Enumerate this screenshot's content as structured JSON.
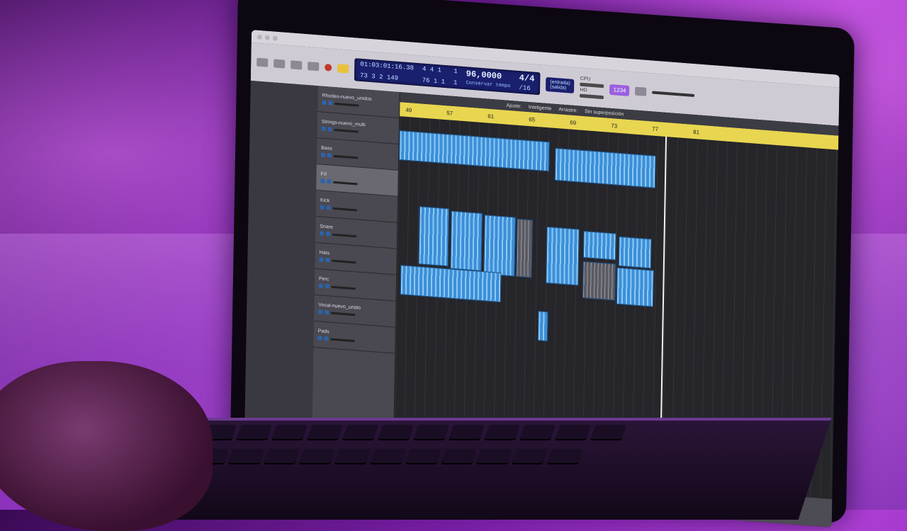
{
  "transport": {
    "timecode": "01:03:01:16.38",
    "bars_beats": "73 3 2 149",
    "position_top": "4 4 1",
    "position_bottom": "76 1 1",
    "sub_top": "1",
    "sub_bottom": "1",
    "tempo": "96,0000",
    "tempo_label": "Conservar tempo",
    "signature": "4/4",
    "division": "/16",
    "input_label": "(entrada)",
    "output_label": "(salida)",
    "badge": "1234"
  },
  "cpu": {
    "cpu_label": "CPU",
    "hd_label": "HD"
  },
  "arrange": {
    "snap_label": "Ajuste:",
    "snap_value": "Inteligente",
    "drag_label": "Arrastre:",
    "drag_value": "Sin superposición",
    "ruler": [
      "49",
      "57",
      "61",
      "65",
      "69",
      "73",
      "77",
      "81"
    ]
  },
  "tracks": [
    {
      "name": "Rhodes-nuevo_unidos",
      "selected": false
    },
    {
      "name": "Strings-nuevo_multi",
      "selected": false
    },
    {
      "name": "Bass",
      "selected": false
    },
    {
      "name": "FX",
      "selected": true
    },
    {
      "name": "Kick",
      "selected": false
    },
    {
      "name": "Snare",
      "selected": false
    },
    {
      "name": "Hats",
      "selected": false
    },
    {
      "name": "Perc",
      "selected": false
    },
    {
      "name": "Vocal-nuevo_unido",
      "selected": false
    },
    {
      "name": "Pads",
      "selected": false
    }
  ],
  "dock": [
    {
      "icon": "finder-icon",
      "color": "#3a8ee6"
    },
    {
      "icon": "launchpad-icon",
      "color": "#7a7a88"
    },
    {
      "icon": "safari-icon",
      "color": "#2e8fe0"
    },
    {
      "icon": "photos-icon",
      "color": "#e9a03b"
    },
    {
      "icon": "files-icon",
      "color": "#4a9ae8"
    },
    {
      "icon": "chrome-icon",
      "color": "#e84a3b"
    },
    {
      "icon": "notes-icon",
      "color": "#f2d14a"
    },
    {
      "icon": "calendar-icon",
      "color": "#f0f0f0"
    },
    {
      "icon": "appletv-icon",
      "color": "#111111"
    },
    {
      "icon": "systemprefs-icon",
      "color": "#8a8a90"
    },
    {
      "icon": "appstore-icon",
      "color": "#2f8cf0"
    },
    {
      "icon": "logic-icon",
      "color": "#3a3a3a"
    },
    {
      "icon": "podcasts-icon",
      "color": "#b04ae8"
    },
    {
      "icon": "whatsapp-icon",
      "color": "#2ecc71"
    },
    {
      "icon": "trash-icon",
      "color": "#cfcfd4"
    }
  ]
}
